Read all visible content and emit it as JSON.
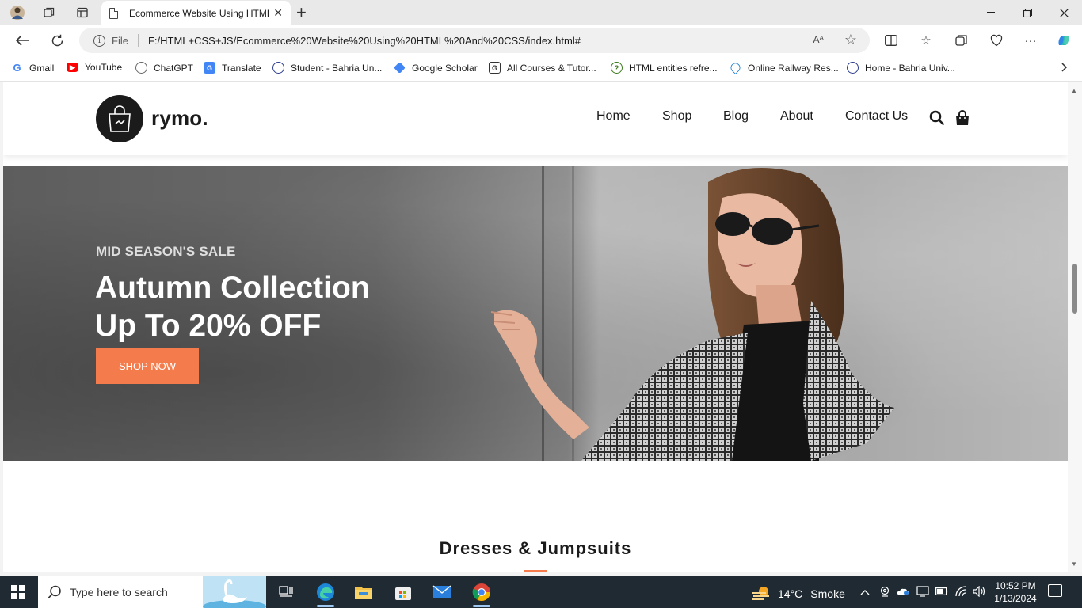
{
  "browser": {
    "tab_title": "Ecommerce Website Using HTML",
    "url_scheme": "File",
    "url": "F:/HTML+CSS+JS/Ecommerce%20Website%20Using%20HTML%20And%20CSS/index.html#",
    "read_aloud": "Aᴬ",
    "bookmarks": [
      {
        "label": "Gmail",
        "icon": "google-icon"
      },
      {
        "label": "YouTube",
        "icon": "youtube-icon"
      },
      {
        "label": "ChatGPT",
        "icon": "chatgpt-icon"
      },
      {
        "label": "Translate",
        "icon": "translate-icon"
      },
      {
        "label": "Student - Bahria Un...",
        "icon": "bahria-icon"
      },
      {
        "label": "Google Scholar",
        "icon": "scholar-icon"
      },
      {
        "label": "All Courses & Tutor...",
        "icon": "courses-icon"
      },
      {
        "label": "HTML entities refre...",
        "icon": "question-icon"
      },
      {
        "label": "Online Railway Res...",
        "icon": "railway-icon"
      },
      {
        "label": "Home - Bahria Univ...",
        "icon": "bahria-icon"
      }
    ]
  },
  "site": {
    "logo_text": "rymo.",
    "nav": [
      "Home",
      "Shop",
      "Blog",
      "About",
      "Contact Us"
    ],
    "hero": {
      "subtitle": "MID SEASON'S SALE",
      "title_line1": "Autumn Collection",
      "title_line2": "Up To 20% OFF",
      "button": "SHOP NOW"
    },
    "section_title": "Dresses & Jumpsuits",
    "accent": "#f47c4c"
  },
  "taskbar": {
    "search_placeholder": "Type here to search",
    "temperature": "14°C",
    "condition": "Smoke",
    "time": "10:52 PM",
    "date": "1/13/2024"
  }
}
